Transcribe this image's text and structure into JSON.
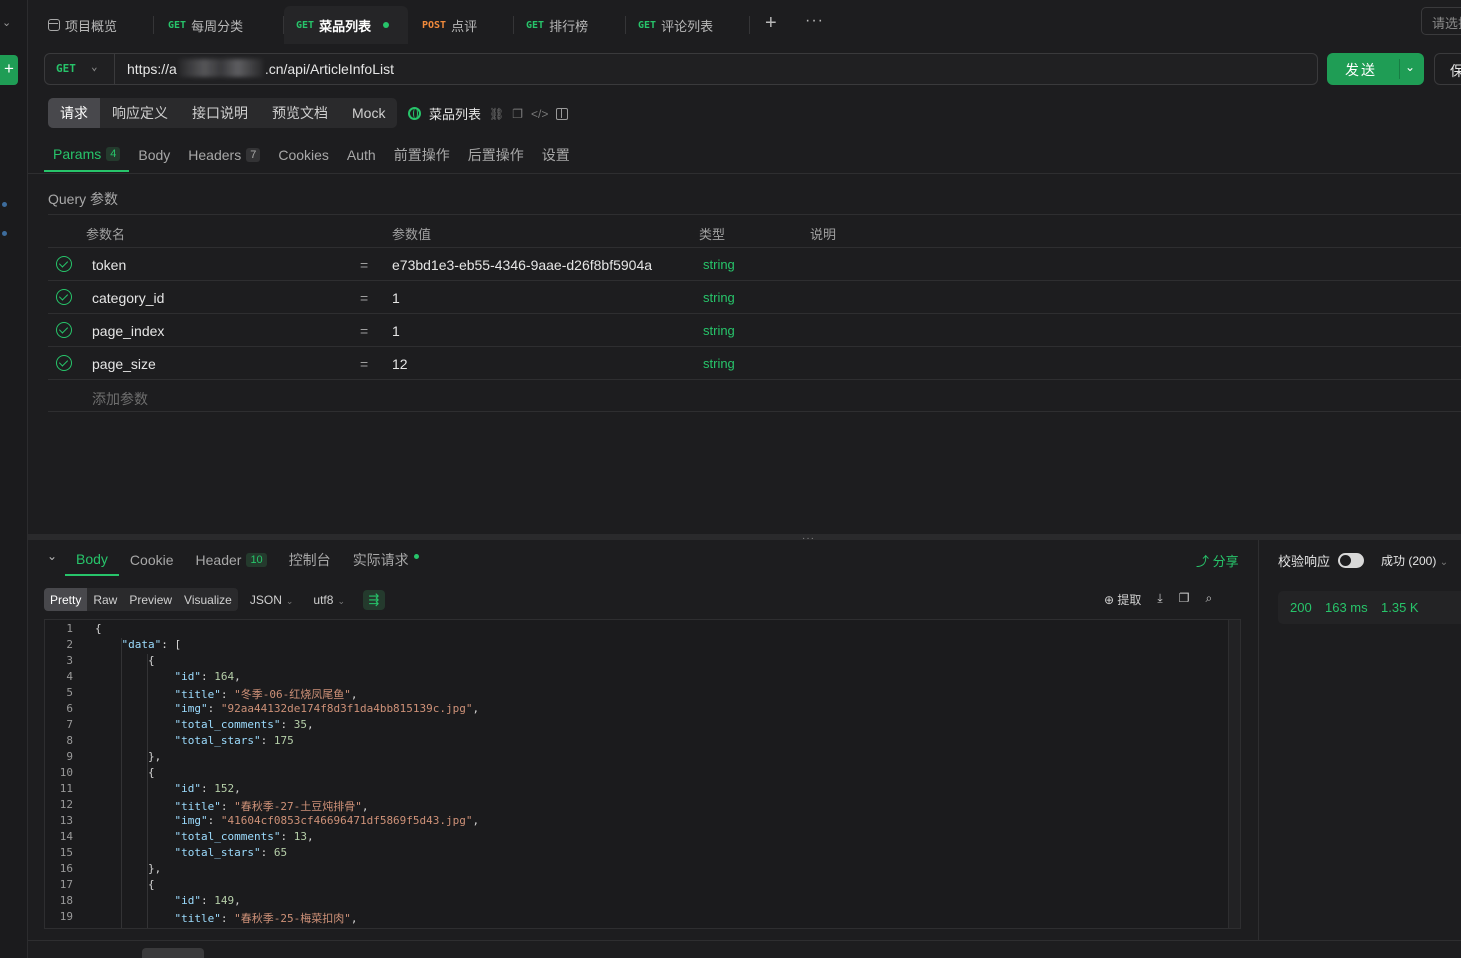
{
  "tabs": [
    {
      "method": "",
      "label": "项目概览",
      "icon": "project-overview-icon"
    },
    {
      "method": "GET",
      "label": "每周分类"
    },
    {
      "method": "GET",
      "label": "菜品列表",
      "active": true
    },
    {
      "method": "POST",
      "label": "点评"
    },
    {
      "method": "GET",
      "label": "排行榜"
    },
    {
      "method": "GET",
      "label": "评论列表"
    }
  ],
  "env_select": "请选择",
  "request": {
    "method": "GET",
    "url_prefix": "https://a",
    "url_suffix": ".cn/api/ArticleInfoList",
    "send_label": "发送",
    "save_label": "保"
  },
  "sub_tabs": [
    "请求",
    "响应定义",
    "接口说明",
    "预览文档",
    "Mock"
  ],
  "api_name": "菜品列表",
  "param_tabs": [
    {
      "label": "Params",
      "badge": "4"
    },
    {
      "label": "Body"
    },
    {
      "label": "Headers",
      "badge": "7"
    },
    {
      "label": "Cookies"
    },
    {
      "label": "Auth"
    },
    {
      "label": "前置操作"
    },
    {
      "label": "后置操作"
    },
    {
      "label": "设置"
    }
  ],
  "query_label": "Query 参数",
  "param_headers": {
    "name": "参数名",
    "value": "参数值",
    "type": "类型",
    "desc": "说明"
  },
  "params": [
    {
      "name": "token",
      "value": "e73bd1e3-eb55-4346-9aae-d26f8bf5904a",
      "type": "string"
    },
    {
      "name": "category_id",
      "value": "1",
      "type": "string"
    },
    {
      "name": "page_index",
      "value": "1",
      "type": "string"
    },
    {
      "name": "page_size",
      "value": "12",
      "type": "string"
    }
  ],
  "add_param_label": "添加参数",
  "response_tabs": [
    {
      "label": "Body"
    },
    {
      "label": "Cookie"
    },
    {
      "label": "Header",
      "badge": "10"
    },
    {
      "label": "控制台"
    },
    {
      "label": "实际请求"
    }
  ],
  "share_label": "分享",
  "format_tabs": [
    "Pretty",
    "Raw",
    "Preview",
    "Visualize"
  ],
  "format_type": "JSON",
  "encoding": "utf8",
  "extract_label": "提取",
  "verify_label": "校验响应",
  "status_select": "成功 (200)",
  "stats": {
    "status": "200",
    "time": "163 ms",
    "size": "1.35 K"
  },
  "code_lines": [
    {
      "n": "1",
      "indent": 0,
      "t": "{"
    },
    {
      "n": "2",
      "indent": 1,
      "k": "\"data\"",
      "t": ": ["
    },
    {
      "n": "3",
      "indent": 2,
      "t": "{"
    },
    {
      "n": "4",
      "indent": 3,
      "k": "\"id\"",
      "t": ": ",
      "v": "164",
      "vt": "n",
      "e": ","
    },
    {
      "n": "5",
      "indent": 3,
      "k": "\"title\"",
      "t": ": ",
      "v": "\"冬季-06-红烧凤尾鱼\"",
      "vt": "s",
      "e": ","
    },
    {
      "n": "6",
      "indent": 3,
      "k": "\"img\"",
      "t": ": ",
      "v": "\"92aa44132de174f8d3f1da4bb815139c.jpg\"",
      "vt": "s",
      "e": ","
    },
    {
      "n": "7",
      "indent": 3,
      "k": "\"total_comments\"",
      "t": ": ",
      "v": "35",
      "vt": "n",
      "e": ","
    },
    {
      "n": "8",
      "indent": 3,
      "k": "\"total_stars\"",
      "t": ": ",
      "v": "175",
      "vt": "n",
      "e": ""
    },
    {
      "n": "9",
      "indent": 2,
      "t": "},"
    },
    {
      "n": "10",
      "indent": 2,
      "t": "{"
    },
    {
      "n": "11",
      "indent": 3,
      "k": "\"id\"",
      "t": ": ",
      "v": "152",
      "vt": "n",
      "e": ","
    },
    {
      "n": "12",
      "indent": 3,
      "k": "\"title\"",
      "t": ": ",
      "v": "\"春秋季-27-土豆炖排骨\"",
      "vt": "s",
      "e": ","
    },
    {
      "n": "13",
      "indent": 3,
      "k": "\"img\"",
      "t": ": ",
      "v": "\"41604cf0853cf46696471df5869f5d43.jpg\"",
      "vt": "s",
      "e": ","
    },
    {
      "n": "14",
      "indent": 3,
      "k": "\"total_comments\"",
      "t": ": ",
      "v": "13",
      "vt": "n",
      "e": ","
    },
    {
      "n": "15",
      "indent": 3,
      "k": "\"total_stars\"",
      "t": ": ",
      "v": "65",
      "vt": "n",
      "e": ""
    },
    {
      "n": "16",
      "indent": 2,
      "t": "},"
    },
    {
      "n": "17",
      "indent": 2,
      "t": "{"
    },
    {
      "n": "18",
      "indent": 3,
      "k": "\"id\"",
      "t": ": ",
      "v": "149",
      "vt": "n",
      "e": ","
    },
    {
      "n": "19",
      "indent": 3,
      "k": "\"title\"",
      "t": ": ",
      "v": "\"春秋季-25-梅菜扣肉\"",
      "vt": "s",
      "e": ","
    }
  ],
  "colors": {
    "accent": "#27c46a",
    "post": "#f08a3c",
    "bg": "#1d1d1f"
  }
}
